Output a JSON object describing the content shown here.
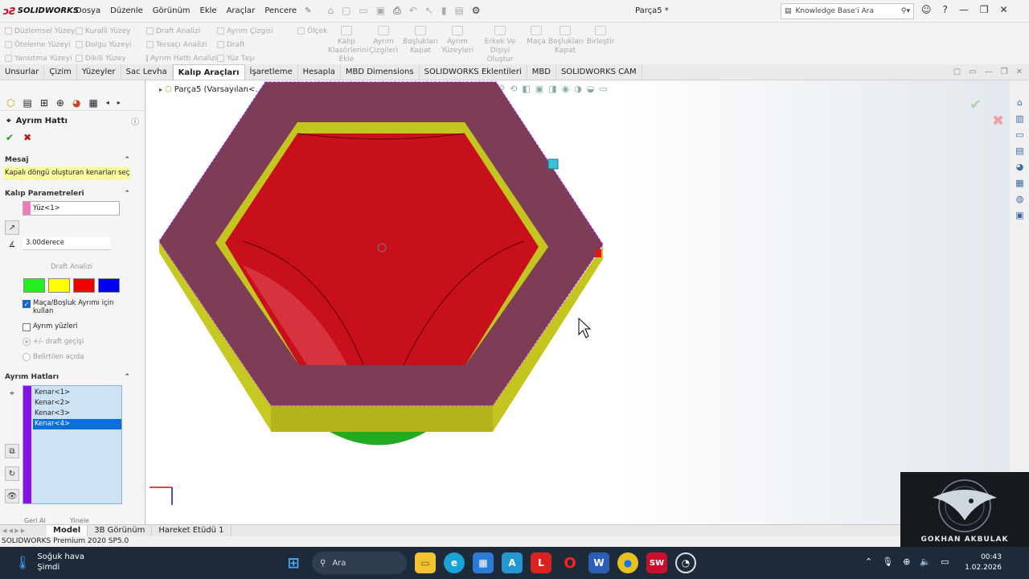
{
  "app": {
    "brand": "SOLIDWORKS",
    "doc_title": "Parça5 *",
    "menu": [
      "Dosya",
      "Düzenle",
      "Görünüm",
      "Ekle",
      "Araçlar",
      "Pencere"
    ],
    "search_placeholder": "Knowledge Base'i Ara"
  },
  "ribbon": {
    "small_items": [
      "Düzlemsel Yüzey",
      "Kuralli Yüzey",
      "Draft Analizi",
      "Ayrım Çizgisi",
      "Ölçek",
      "Öteleme Yüzeyi",
      "Dolgu Yüzeyi",
      "Tersaçı Analizi",
      "Draft",
      "",
      "Yansıtma Yüzeyi",
      "Dikili Yüzey",
      "Ayrım Hattı Analizi",
      "Yüz Taşı",
      ""
    ],
    "big_items": [
      "Kalıp Klasörlerini Ekle",
      "Ayrım Çizgileri",
      "Boşlukları Kapat",
      "Ayrım Yüzeyleri",
      "Erkek Ve Dişiyi Oluştur",
      "Maça",
      "Boşlukları Kapat",
      "Birleştir"
    ]
  },
  "tabs": [
    "Unsurlar",
    "Çizim",
    "Yüzeyler",
    "Sac Levha",
    "Kalıp Araçları",
    "İşaretleme",
    "Hesapla",
    "MBD Dimensions",
    "SOLIDWORKS Eklentileri",
    "MBD",
    "SOLIDWORKS CAM"
  ],
  "active_tab": "Kalıp Araçları",
  "panel": {
    "title": "Ayrım Hattı",
    "message_header": "Mesaj",
    "message": "Kapalı döngü oluşturan kenarları seçin.",
    "params_header": "Kalıp Parametreleri",
    "face": "Yüz<1>",
    "angle": "3.00derece",
    "draft_button": "Draft Analizi",
    "swatch_colors": [
      "#22ee22",
      "#ffff00",
      "#ee0000",
      "#0000ee"
    ],
    "use_core_cavity": "Maça/Boşluk Ayrımı için kullan",
    "parting_faces": "Ayrım yüzleri",
    "radio1": "+/- draft geçişi",
    "radio2": "Belirtilen açıda",
    "lines_header": "Ayrım Hatları",
    "edges": [
      "Kenar<1>",
      "Kenar<2>",
      "Kenar<3>",
      "Kenar<4>"
    ],
    "selected_edge": 3,
    "bottom_partial_1": "Geri Al",
    "bottom_partial_2": "Yinele"
  },
  "viewport": {
    "tree_label": "Parça5  (Varsayılan<..."
  },
  "bottom_tabs": [
    "Model",
    "3B Görünüm",
    "Hareket Etüdü 1"
  ],
  "status": "SOLIDWORKS Premium 2020 SP5.0",
  "watermark": "GOKHAN AKBULAK",
  "taskbar": {
    "weather_line1": "Soğuk hava",
    "weather_line2": "Şimdi",
    "search_label": "Ara",
    "time": "00:43",
    "date": "1.02.2026"
  },
  "colors": {
    "accent_blue": "#0a6fd8",
    "model_frame": "#7e3d57",
    "model_wall": "#c4c61f",
    "model_cavity": "#c8101c",
    "edge_bar": "#8a10e8"
  }
}
